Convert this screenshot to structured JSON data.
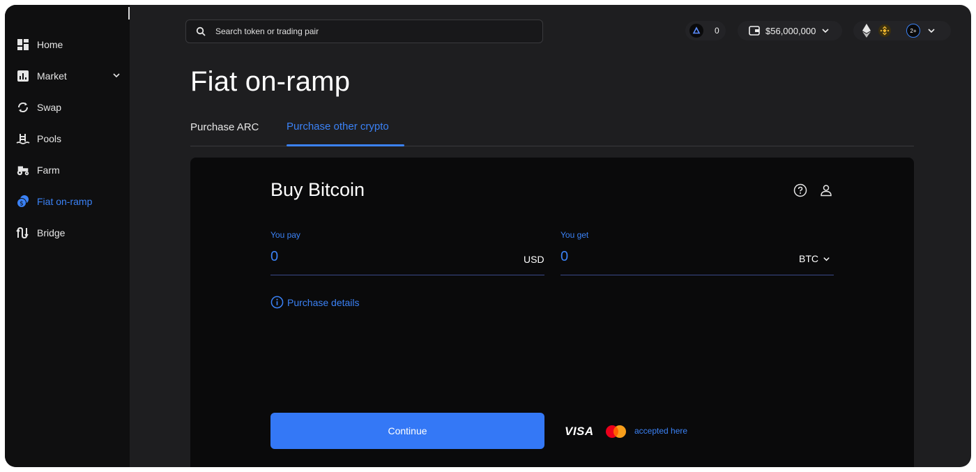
{
  "sidebar": {
    "items": [
      {
        "label": "Home",
        "icon": "dashboard-icon"
      },
      {
        "label": "Market",
        "icon": "chart-icon"
      },
      {
        "label": "Swap",
        "icon": "swap-icon"
      },
      {
        "label": "Pools",
        "icon": "pool-icon"
      },
      {
        "label": "Farm",
        "icon": "tractor-icon"
      },
      {
        "label": "Fiat on-ramp",
        "icon": "coins-icon",
        "active": true
      },
      {
        "label": "Bridge",
        "icon": "bridge-icon"
      }
    ]
  },
  "header": {
    "search_placeholder": "Search token or trading pair",
    "arc_count": "0",
    "wallet_balance": "$56,000,000",
    "network_more": "2+"
  },
  "page": {
    "title": "Fiat on-ramp",
    "tabs": [
      {
        "label": "Purchase ARC",
        "active": false
      },
      {
        "label": "Purchase other crypto",
        "active": true
      }
    ]
  },
  "card": {
    "title": "Buy Bitcoin",
    "pay_label": "You pay",
    "pay_value": "0",
    "pay_currency": "USD",
    "get_label": "You get",
    "get_value": "0",
    "get_currency": "BTC",
    "details_label": "Purchase details",
    "continue_label": "Continue",
    "visa_label": "VISA",
    "accepted_label": "accepted here"
  },
  "colors": {
    "accent": "#3b82f6",
    "background": "#1e1e20",
    "sidebar": "#0f0f10",
    "card": "#0a0a0b",
    "button": "#3478f6"
  }
}
